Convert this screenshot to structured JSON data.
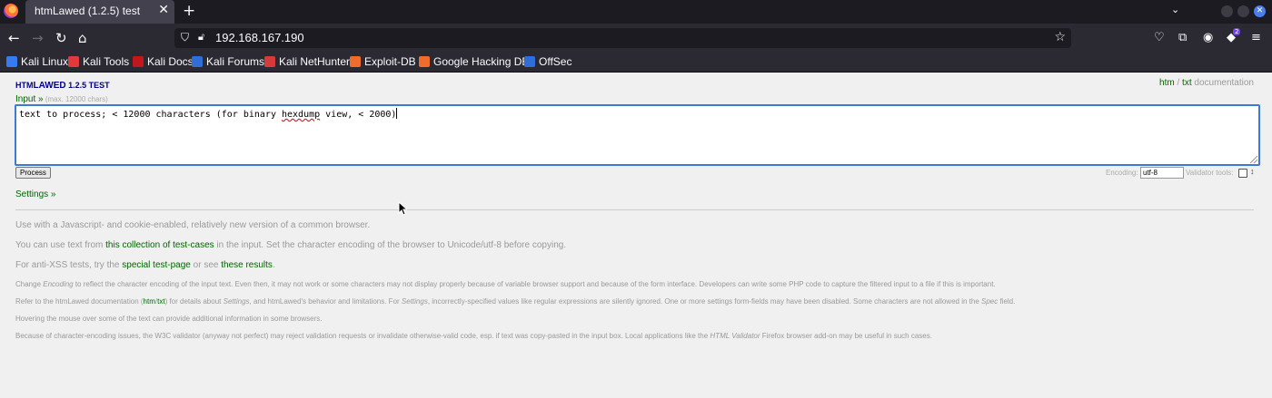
{
  "browser": {
    "tab_title": "htmLawed (1.2.5) test",
    "tab_close": "✕",
    "new_tab": "+",
    "url": "192.168.167.190",
    "extensions_badge": "2"
  },
  "bookmarks": [
    {
      "label": "Kali Linux",
      "icon_color": "#367bf0"
    },
    {
      "label": "Kali Tools",
      "icon_color": "#e03a3e"
    },
    {
      "label": "Kali Docs",
      "icon_color": "#c4171c"
    },
    {
      "label": "Kali Forums",
      "icon_color": "#2f6ed8"
    },
    {
      "label": "Kali NetHunter",
      "icon_color": "#d63a3a"
    },
    {
      "label": "Exploit-DB",
      "icon_color": "#ef6c2a"
    },
    {
      "label": "Google Hacking DB",
      "icon_color": "#ef6c2a"
    },
    {
      "label": "OffSec",
      "icon_color": "#2f6ed8"
    }
  ],
  "page": {
    "brand_html": "HTM",
    "brand_lawed": "LAWED",
    "brand_version": "1.2.5",
    "brand_test": "TEST",
    "doc_htm": "htm",
    "doc_sep": " / ",
    "doc_txt": "txt",
    "doc_word": " documentation",
    "input_label": "Input »",
    "input_hint": " (max. 12000 chars)",
    "textarea_before": "text to process; < 12000 characters (for binary ",
    "textarea_misspelled": "hexdump",
    "textarea_after": " view, < 2000)",
    "process_label": "Process",
    "encoding_label": "Encoding:",
    "encoding_value": "utf-8",
    "validator_label": "Validator tools:",
    "settings_label": "Settings »",
    "p1": "Use with a Javascript- and cookie-enabled, relatively new version of a common browser.",
    "p2_a": "You can use text from ",
    "p2_link": "this collection of test-cases",
    "p2_b": " in the input. Set the character encoding of the browser to Unicode/utf-8 before copying.",
    "p3_a": "For anti-XSS tests, try the ",
    "p3_link1": "special test-page",
    "p3_b": " or see ",
    "p3_link2": "these results",
    "p3_c": ".",
    "p4_a": "Change ",
    "p4_em": "Encoding",
    "p4_b": " to reflect the character encoding of the input text. Even then, it may not work or some characters may not display properly because of variable browser support and because of the form interface. Developers can write some PHP code to capture the filtered input to a file if this is important.",
    "p5_a": "Refer to the htmLawed documentation (",
    "p5_htm": "htm",
    "p5_slash": "/",
    "p5_txt": "txt",
    "p5_b": ") for details about ",
    "p5_em1": "Settings",
    "p5_c": ", and htmLawed's behavior and limitations. For ",
    "p5_em2": "Settings",
    "p5_d": ", incorrectly-specified values like regular expressions are silently ignored. One or more settings form-fields may have been disabled. Some characters are not allowed in the ",
    "p5_em3": "Spec",
    "p5_e": " field.",
    "p6": "Hovering the mouse over some of the text can provide additional information in some browsers.",
    "p7_a": "Because of character-encoding issues, the W3C validator (anyway not perfect) may reject validation requests or invalidate otherwise-valid code, esp. if text was copy-pasted in the input box. Local applications like the ",
    "p7_em": "HTML Validator",
    "p7_b": " Firefox browser add-on may be useful in such cases."
  }
}
